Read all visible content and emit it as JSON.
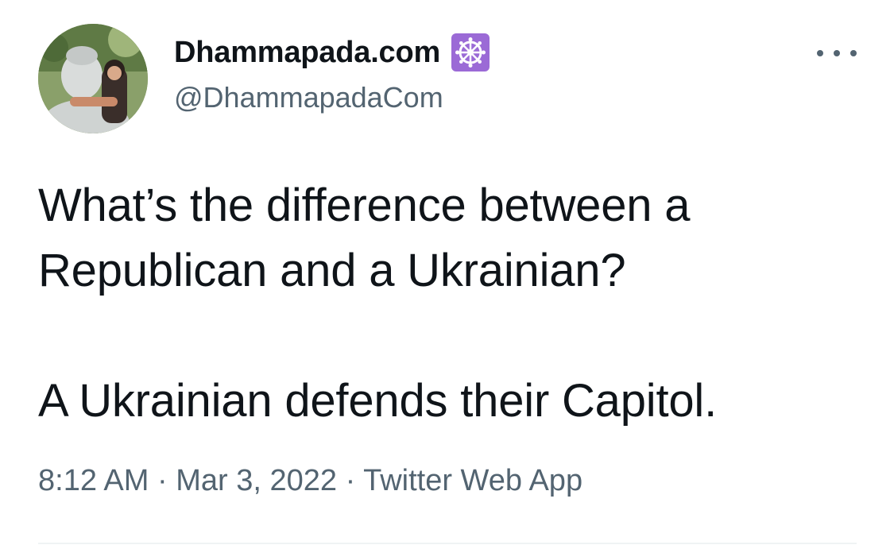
{
  "author": {
    "display_name": "Dhammapada.com",
    "handle": "@DhammapadaCom",
    "badge_icon": "dharma-wheel-icon",
    "badge_color": "#9b6ad6"
  },
  "tweet": {
    "lines": [
      "What’s the difference between a",
      "Republican and a Ukrainian?",
      "A Ukrainian defends their Capitol."
    ],
    "time": "8:12 AM",
    "separator": "·",
    "date": "Mar 3, 2022",
    "source": "Twitter Web App"
  },
  "menu": {
    "icon": "more-options-icon"
  }
}
